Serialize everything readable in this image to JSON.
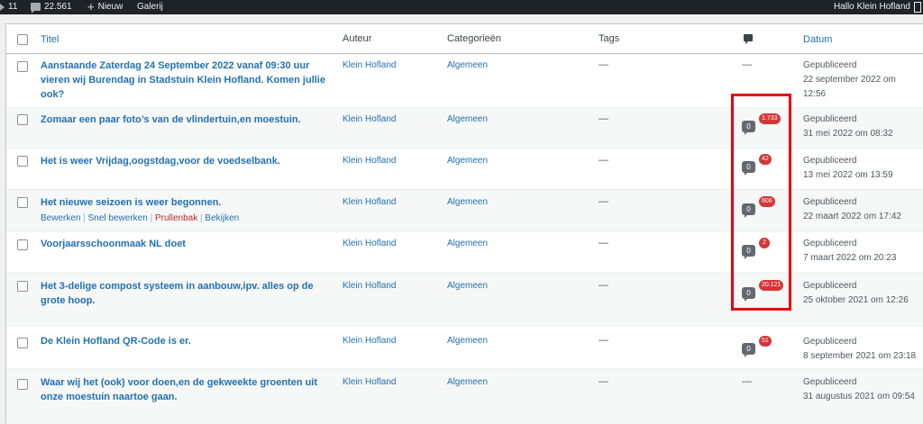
{
  "adminbar": {
    "updates_count": "11",
    "comments_count": "22.561",
    "new_label": "Nieuw",
    "gallery_label": "Galerij",
    "greeting": "Hallo Klein Hofland"
  },
  "table": {
    "headers": {
      "title": "Titel",
      "author": "Auteur",
      "categories": "Categorieën",
      "tags": "Tags",
      "comments_icon": "comment-bubble-icon",
      "date": "Datum"
    },
    "row_actions": {
      "edit": "Bewerken",
      "quick_edit": "Snel bewerken",
      "trash": "Prullenbak",
      "view": "Bekijken",
      "separator": "|"
    },
    "rows": [
      {
        "title": "Aanstaande Zaterdag 24 September 2022 vanaf 09:30 uur vieren wij Burendag in Stadstuin Klein Hofland. Komen jullie ook?",
        "author": "Klein Hofland",
        "category": "Algemeen",
        "tags": "—",
        "comments_none": "—",
        "status": "Gepubliceerd",
        "date": "22 september 2022 om 12:56"
      },
      {
        "title": "Zomaar een paar foto’s van de vlindertuin,en moestuin.",
        "author": "Klein Hofland",
        "category": "Algemeen",
        "tags": "—",
        "approved": "0",
        "pending": "1.733",
        "status": "Gepubliceerd",
        "date": "31 mei 2022 om 08:32"
      },
      {
        "title": "Het is weer Vrijdag,oogstdag,voor de voedselbank.",
        "author": "Klein Hofland",
        "category": "Algemeen",
        "tags": "—",
        "approved": "0",
        "pending": "42",
        "status": "Gepubliceerd",
        "date": "13 mei 2022 om 13:59"
      },
      {
        "title": "Het nieuwe seizoen is weer begonnen.",
        "author": "Klein Hofland",
        "category": "Algemeen",
        "tags": "—",
        "approved": "0",
        "pending": "606",
        "status": "Gepubliceerd",
        "date": "22 maart 2022 om 17:42"
      },
      {
        "title": "Voorjaarsschoonmaak NL doet",
        "author": "Klein Hofland",
        "category": "Algemeen",
        "tags": "—",
        "approved": "0",
        "pending": "2",
        "status": "Gepubliceerd",
        "date": "7 maart 2022 om 20:23"
      },
      {
        "title": "Het 3-delige compost systeem in aanbouw,ipv. alles op de grote hoop.",
        "author": "Klein Hofland",
        "category": "Algemeen",
        "tags": "—",
        "approved": "0",
        "pending": "20.121",
        "status": "Gepubliceerd",
        "date": "25 oktober 2021 om 12:26"
      },
      {
        "title": "De Klein Hofland QR-Code is er.",
        "author": "Klein Hofland",
        "category": "Algemeen",
        "tags": "—",
        "approved": "0",
        "pending": "51",
        "status": "Gepubliceerd",
        "date": "8 september 2021 om 23:18"
      },
      {
        "title": "Waar wij het (ook) voor doen,en de gekweekte groenten uit onze moestuin naartoe gaan.",
        "author": "Klein Hofland",
        "category": "Algemeen",
        "tags": "—",
        "comments_none": "—",
        "status": "Gepubliceerd",
        "date": "31 augustus 2021 om 09:54"
      }
    ]
  },
  "colors": {
    "link": "#2271b1",
    "adminbar": "#1d2327",
    "pending_badge": "#d63638",
    "highlight_box": "#e8000e"
  }
}
